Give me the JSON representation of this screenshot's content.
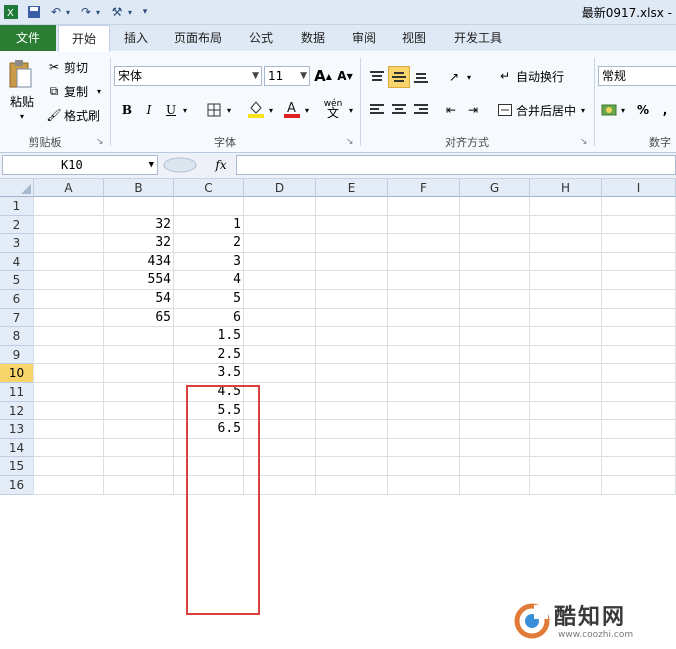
{
  "window": {
    "title": "最新0917.xlsx -"
  },
  "tabs": [
    "文件",
    "开始",
    "插入",
    "页面布局",
    "公式",
    "数据",
    "审阅",
    "视图",
    "开发工具"
  ],
  "clipboard": {
    "paste": "粘贴",
    "cut": "剪切",
    "copy": "复制",
    "format_painter": "格式刷",
    "group": "剪贴板"
  },
  "font": {
    "name": "宋体",
    "size": "11",
    "grow": "A",
    "shrink": "A",
    "bold": "B",
    "italic": "I",
    "underline": "U",
    "group": "字体",
    "phonetic": "wén"
  },
  "alignment": {
    "wrap_text": "自动换行",
    "merge_center": "合并后居中",
    "group": "对齐方式"
  },
  "number": {
    "format": "常规",
    "percent": "%",
    "comma": ",",
    "group": "数字"
  },
  "formula_bar": {
    "name_box": "K10",
    "fx": "fx",
    "value": ""
  },
  "columns": [
    "A",
    "B",
    "C",
    "D",
    "E",
    "F",
    "G",
    "H",
    "I"
  ],
  "selected_column": "K",
  "selected_row": 10,
  "rows": [
    {
      "n": "1",
      "B": "",
      "C": ""
    },
    {
      "n": "2",
      "B": "32",
      "C": "1"
    },
    {
      "n": "3",
      "B": "32",
      "C": "2"
    },
    {
      "n": "4",
      "B": "434",
      "C": "3"
    },
    {
      "n": "5",
      "B": "554",
      "C": "4"
    },
    {
      "n": "6",
      "B": "54",
      "C": "5"
    },
    {
      "n": "7",
      "B": "65",
      "C": "6"
    },
    {
      "n": "8",
      "B": "",
      "C": "1.5"
    },
    {
      "n": "9",
      "B": "",
      "C": "2.5"
    },
    {
      "n": "10",
      "B": "",
      "C": "3.5"
    },
    {
      "n": "11",
      "B": "",
      "C": "4.5"
    },
    {
      "n": "12",
      "B": "",
      "C": "5.5"
    },
    {
      "n": "13",
      "B": "",
      "C": "6.5"
    },
    {
      "n": "14",
      "B": "",
      "C": ""
    },
    {
      "n": "15",
      "B": "",
      "C": ""
    },
    {
      "n": "16",
      "B": "",
      "C": ""
    }
  ],
  "watermark": {
    "name": "酷知网",
    "url": "www.coozhi.com"
  },
  "colors": {
    "file_tab": "#2a7d32",
    "highlight_box": "#d9413c",
    "selected_header": "#f8d56b"
  }
}
